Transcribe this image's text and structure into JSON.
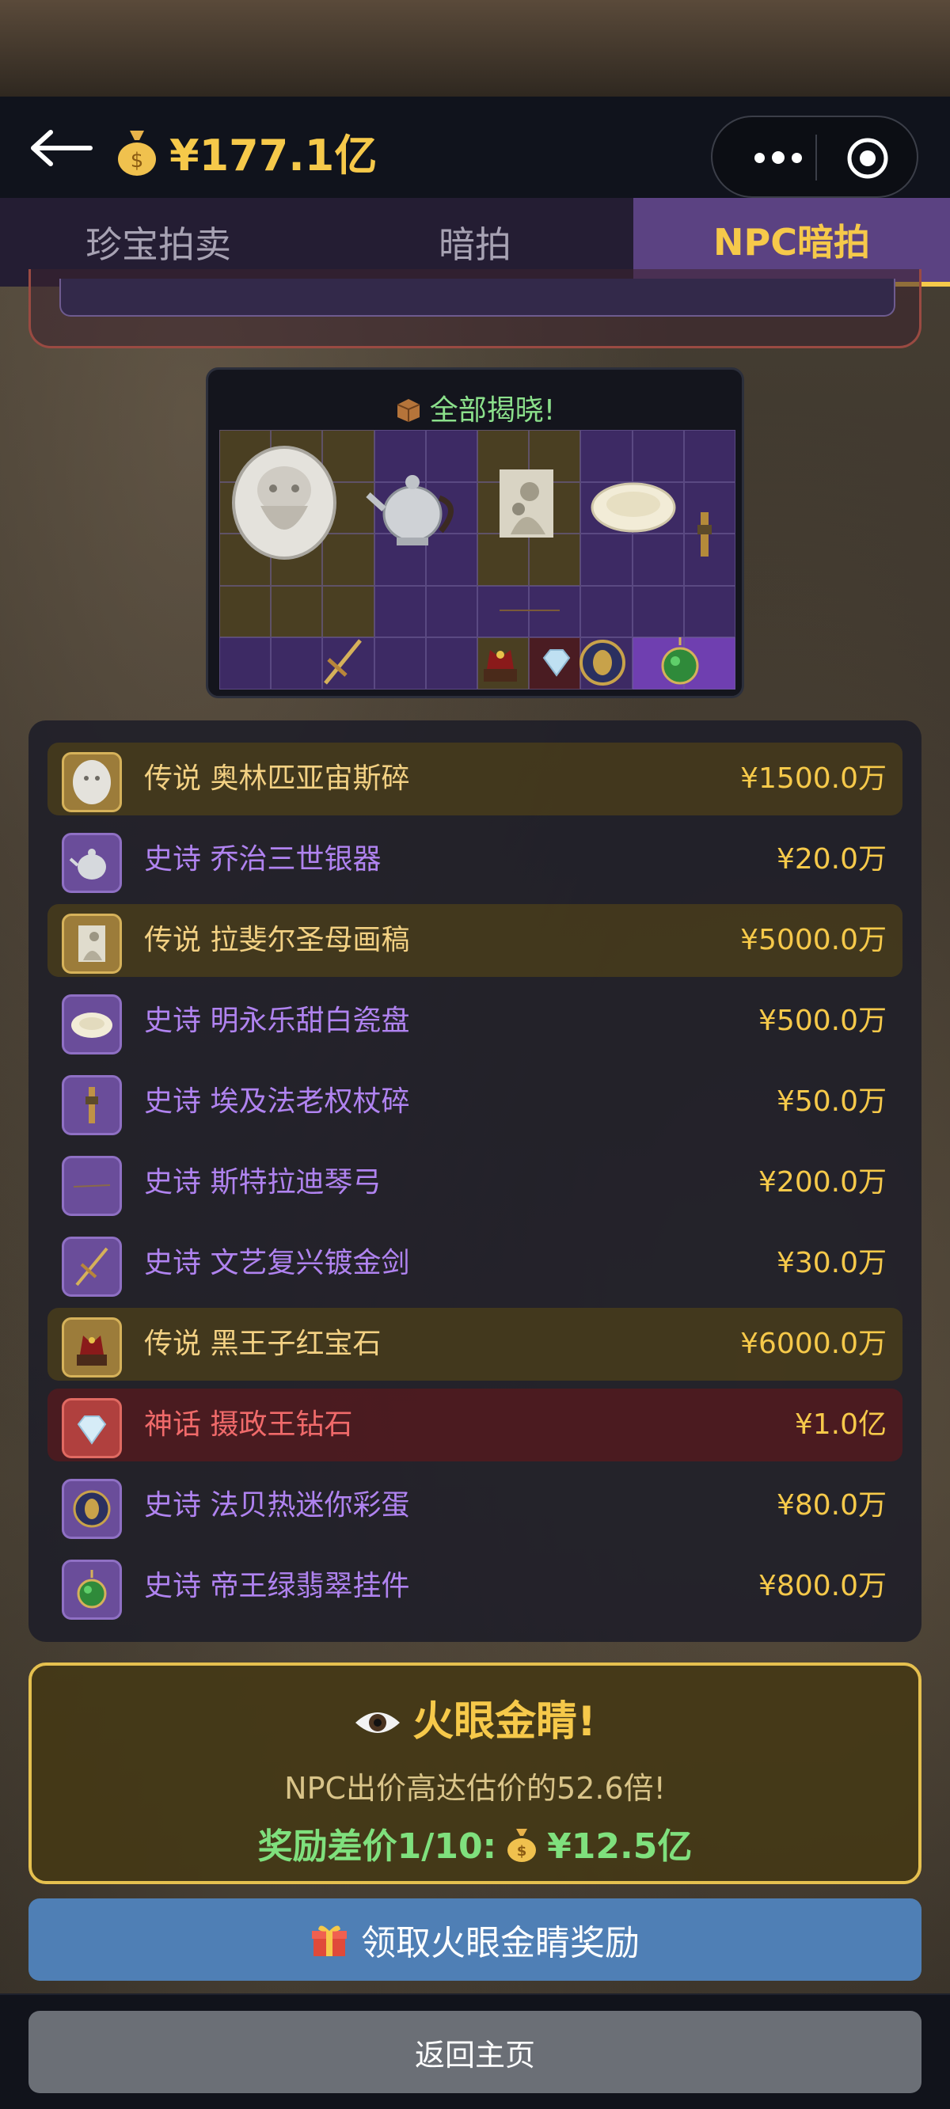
{
  "header": {
    "money_icon": "money-bag-icon",
    "balance": "¥177.1亿"
  },
  "tabs": [
    {
      "label": "珍宝拍卖",
      "active": false
    },
    {
      "label": "暗拍",
      "active": false
    },
    {
      "label": "NPC暗拍",
      "active": true
    }
  ],
  "reveal": {
    "title": "全部揭晓!",
    "icon": "box-icon"
  },
  "items": [
    {
      "rarity": "传说",
      "name": "奥林匹亚宙斯碎",
      "price": "¥1500.0万",
      "tier": "legendary",
      "icon": "zeus-fragment-icon"
    },
    {
      "rarity": "史诗",
      "name": "乔治三世银器",
      "price": "¥20.0万",
      "tier": "epic",
      "icon": "silver-teapot-icon"
    },
    {
      "rarity": "传说",
      "name": "拉斐尔圣母画稿",
      "price": "¥5000.0万",
      "tier": "legendary",
      "icon": "madonna-sketch-icon"
    },
    {
      "rarity": "史诗",
      "name": "明永乐甜白瓷盘",
      "price": "¥500.0万",
      "tier": "epic",
      "icon": "porcelain-plate-icon"
    },
    {
      "rarity": "史诗",
      "name": "埃及法老权杖碎",
      "price": "¥50.0万",
      "tier": "epic",
      "icon": "scepter-fragment-icon"
    },
    {
      "rarity": "史诗",
      "name": "斯特拉迪琴弓",
      "price": "¥200.0万",
      "tier": "epic",
      "icon": "violin-bow-icon"
    },
    {
      "rarity": "史诗",
      "name": "文艺复兴镀金剑",
      "price": "¥30.0万",
      "tier": "epic",
      "icon": "gilded-sword-icon"
    },
    {
      "rarity": "传说",
      "name": "黑王子红宝石",
      "price": "¥6000.0万",
      "tier": "legendary",
      "icon": "crown-ruby-icon"
    },
    {
      "rarity": "神话",
      "name": "摄政王钻石",
      "price": "¥1.0亿",
      "tier": "mythic",
      "icon": "diamond-icon"
    },
    {
      "rarity": "史诗",
      "name": "法贝热迷你彩蛋",
      "price": "¥80.0万",
      "tier": "epic",
      "icon": "faberge-egg-icon"
    },
    {
      "rarity": "史诗",
      "name": "帝王绿翡翠挂件",
      "price": "¥800.0万",
      "tier": "epic",
      "icon": "jade-pendant-icon"
    }
  ],
  "bonus": {
    "title": "火眼金睛!",
    "icon": "eye-icon",
    "subtitle": "NPC出价高达估价的52.6倍!",
    "reward_label": "奖励差价1/10:",
    "reward_value": "¥12.5亿"
  },
  "claim_button": {
    "label": "领取火眼金睛奖励",
    "icon": "gift-icon"
  },
  "home_button": {
    "label": "返回主页"
  },
  "colors": {
    "gold": "#f6c94a",
    "legendary": "#f3d183",
    "epic": "#b083f0",
    "mythic": "#f06a6a",
    "claim_blue": "#4f7fb5"
  }
}
